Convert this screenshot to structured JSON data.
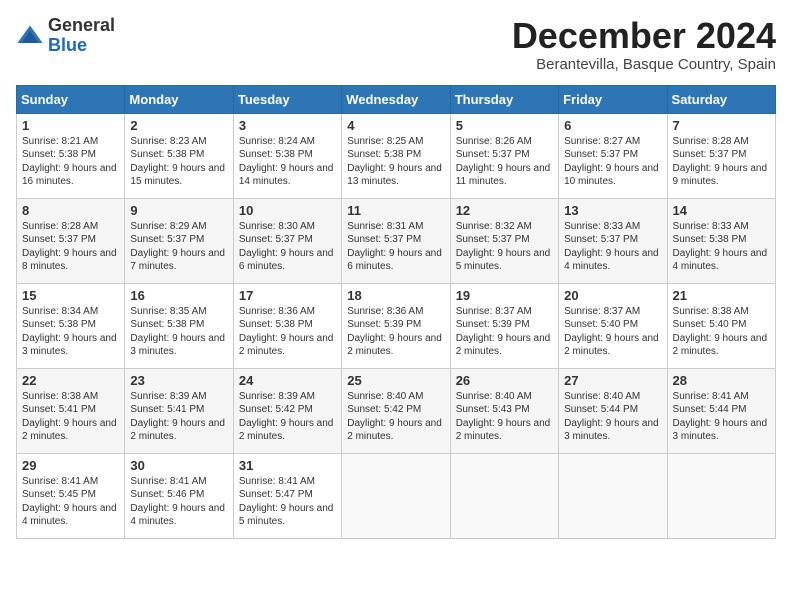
{
  "logo": {
    "general": "General",
    "blue": "Blue"
  },
  "title": "December 2024",
  "subtitle": "Berantevilla, Basque Country, Spain",
  "days": [
    "Sunday",
    "Monday",
    "Tuesday",
    "Wednesday",
    "Thursday",
    "Friday",
    "Saturday"
  ],
  "weeks": [
    [
      {
        "day": "1",
        "sunrise": "8:21 AM",
        "sunset": "5:38 PM",
        "daylight": "9 hours and 16 minutes."
      },
      {
        "day": "2",
        "sunrise": "8:23 AM",
        "sunset": "5:38 PM",
        "daylight": "9 hours and 15 minutes."
      },
      {
        "day": "3",
        "sunrise": "8:24 AM",
        "sunset": "5:38 PM",
        "daylight": "9 hours and 14 minutes."
      },
      {
        "day": "4",
        "sunrise": "8:25 AM",
        "sunset": "5:38 PM",
        "daylight": "9 hours and 13 minutes."
      },
      {
        "day": "5",
        "sunrise": "8:26 AM",
        "sunset": "5:37 PM",
        "daylight": "9 hours and 11 minutes."
      },
      {
        "day": "6",
        "sunrise": "8:27 AM",
        "sunset": "5:37 PM",
        "daylight": "9 hours and 10 minutes."
      },
      {
        "day": "7",
        "sunrise": "8:28 AM",
        "sunset": "5:37 PM",
        "daylight": "9 hours and 9 minutes."
      }
    ],
    [
      {
        "day": "8",
        "sunrise": "8:28 AM",
        "sunset": "5:37 PM",
        "daylight": "9 hours and 8 minutes."
      },
      {
        "day": "9",
        "sunrise": "8:29 AM",
        "sunset": "5:37 PM",
        "daylight": "9 hours and 7 minutes."
      },
      {
        "day": "10",
        "sunrise": "8:30 AM",
        "sunset": "5:37 PM",
        "daylight": "9 hours and 6 minutes."
      },
      {
        "day": "11",
        "sunrise": "8:31 AM",
        "sunset": "5:37 PM",
        "daylight": "9 hours and 6 minutes."
      },
      {
        "day": "12",
        "sunrise": "8:32 AM",
        "sunset": "5:37 PM",
        "daylight": "9 hours and 5 minutes."
      },
      {
        "day": "13",
        "sunrise": "8:33 AM",
        "sunset": "5:37 PM",
        "daylight": "9 hours and 4 minutes."
      },
      {
        "day": "14",
        "sunrise": "8:33 AM",
        "sunset": "5:38 PM",
        "daylight": "9 hours and 4 minutes."
      }
    ],
    [
      {
        "day": "15",
        "sunrise": "8:34 AM",
        "sunset": "5:38 PM",
        "daylight": "9 hours and 3 minutes."
      },
      {
        "day": "16",
        "sunrise": "8:35 AM",
        "sunset": "5:38 PM",
        "daylight": "9 hours and 3 minutes."
      },
      {
        "day": "17",
        "sunrise": "8:36 AM",
        "sunset": "5:38 PM",
        "daylight": "9 hours and 2 minutes."
      },
      {
        "day": "18",
        "sunrise": "8:36 AM",
        "sunset": "5:39 PM",
        "daylight": "9 hours and 2 minutes."
      },
      {
        "day": "19",
        "sunrise": "8:37 AM",
        "sunset": "5:39 PM",
        "daylight": "9 hours and 2 minutes."
      },
      {
        "day": "20",
        "sunrise": "8:37 AM",
        "sunset": "5:40 PM",
        "daylight": "9 hours and 2 minutes."
      },
      {
        "day": "21",
        "sunrise": "8:38 AM",
        "sunset": "5:40 PM",
        "daylight": "9 hours and 2 minutes."
      }
    ],
    [
      {
        "day": "22",
        "sunrise": "8:38 AM",
        "sunset": "5:41 PM",
        "daylight": "9 hours and 2 minutes."
      },
      {
        "day": "23",
        "sunrise": "8:39 AM",
        "sunset": "5:41 PM",
        "daylight": "9 hours and 2 minutes."
      },
      {
        "day": "24",
        "sunrise": "8:39 AM",
        "sunset": "5:42 PM",
        "daylight": "9 hours and 2 minutes."
      },
      {
        "day": "25",
        "sunrise": "8:40 AM",
        "sunset": "5:42 PM",
        "daylight": "9 hours and 2 minutes."
      },
      {
        "day": "26",
        "sunrise": "8:40 AM",
        "sunset": "5:43 PM",
        "daylight": "9 hours and 2 minutes."
      },
      {
        "day": "27",
        "sunrise": "8:40 AM",
        "sunset": "5:44 PM",
        "daylight": "9 hours and 3 minutes."
      },
      {
        "day": "28",
        "sunrise": "8:41 AM",
        "sunset": "5:44 PM",
        "daylight": "9 hours and 3 minutes."
      }
    ],
    [
      {
        "day": "29",
        "sunrise": "8:41 AM",
        "sunset": "5:45 PM",
        "daylight": "9 hours and 4 minutes."
      },
      {
        "day": "30",
        "sunrise": "8:41 AM",
        "sunset": "5:46 PM",
        "daylight": "9 hours and 4 minutes."
      },
      {
        "day": "31",
        "sunrise": "8:41 AM",
        "sunset": "5:47 PM",
        "daylight": "9 hours and 5 minutes."
      },
      null,
      null,
      null,
      null
    ]
  ],
  "labels": {
    "sunrise": "Sunrise:",
    "sunset": "Sunset:",
    "daylight": "Daylight:"
  }
}
